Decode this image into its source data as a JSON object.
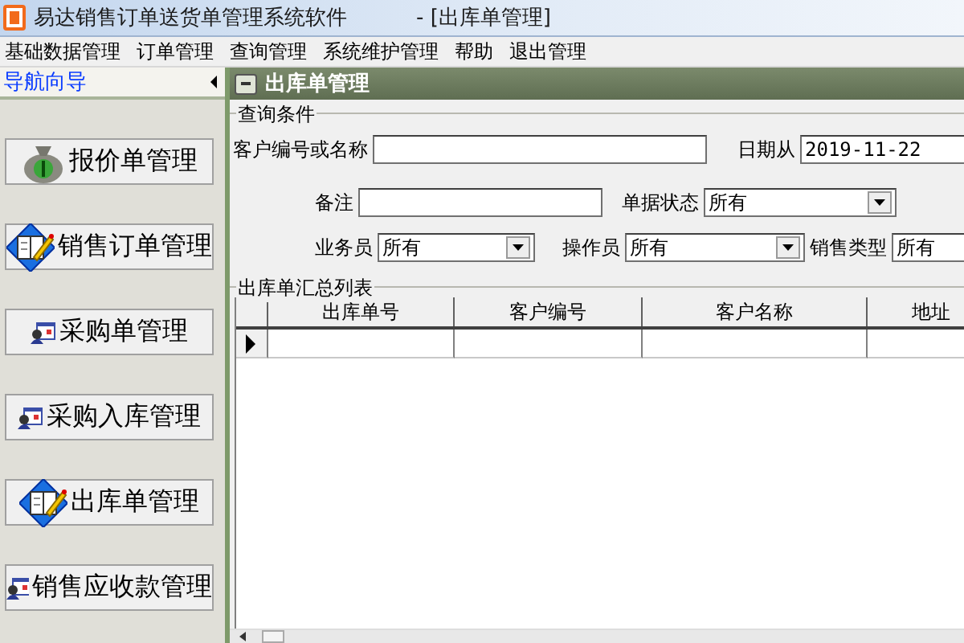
{
  "window": {
    "title": "易达销售订单送货单管理系统软件",
    "document": "- [出库单管理]"
  },
  "menu": [
    "基础数据管理",
    "订单管理",
    "查询管理",
    "系统维护管理",
    "帮助",
    "退出管理"
  ],
  "nav": {
    "title": "导航向导",
    "buttons": [
      {
        "label": "报价单管理",
        "kind": "bag"
      },
      {
        "label": "销售订单管理",
        "kind": "book"
      },
      {
        "label": "采购单管理",
        "kind": "form"
      },
      {
        "label": "采购入库管理",
        "kind": "form"
      },
      {
        "label": "出库单管理",
        "kind": "book"
      },
      {
        "label": "销售应收款管理",
        "kind": "form"
      }
    ]
  },
  "panel": {
    "title": "出库单管理",
    "query": {
      "legend": "查询条件",
      "fields": [
        {
          "label": "客户编号或名称",
          "kind": "text"
        },
        {
          "label": "日期从",
          "kind": "text",
          "value": "2019-11-22"
        },
        {
          "label": "备注",
          "kind": "text"
        },
        {
          "label": "单据状态",
          "kind": "select",
          "value": "所有"
        },
        {
          "label": "业务员",
          "kind": "select",
          "value": "所有"
        },
        {
          "label": "操作员",
          "kind": "select",
          "value": "所有"
        },
        {
          "label": "销售类型",
          "kind": "text",
          "value": "所有"
        }
      ]
    },
    "list": {
      "legend": "出库单汇总列表",
      "columns": [
        "出库单号",
        "客户编号",
        "客户名称",
        "地址"
      ],
      "rows": [
        {
          "current": true
        }
      ]
    }
  }
}
